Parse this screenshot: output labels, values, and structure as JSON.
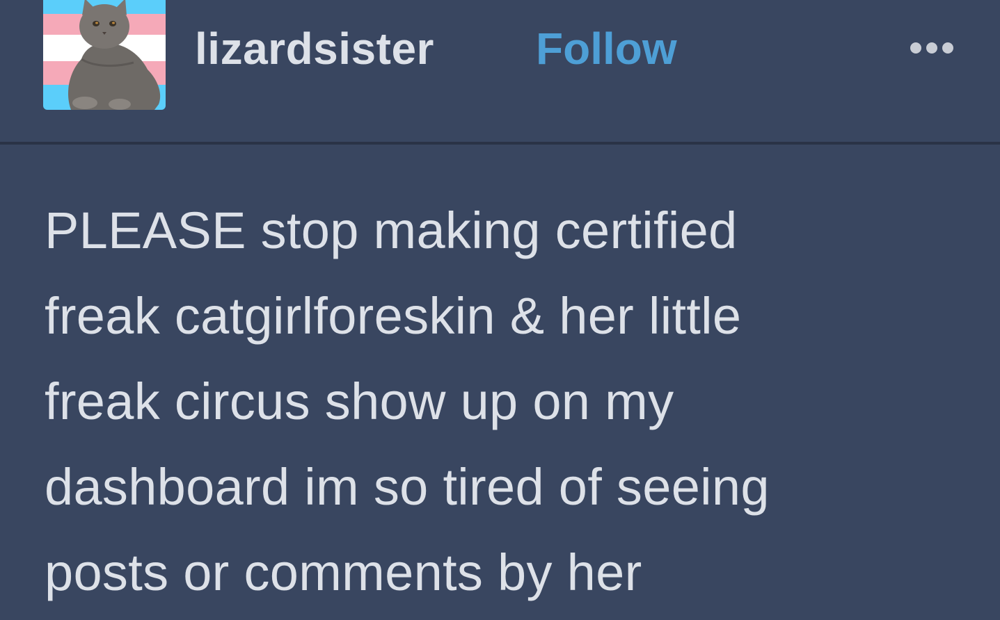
{
  "post": {
    "username": "lizardsister",
    "follow_label": "Follow",
    "more_icon": "ellipsis-icon",
    "body_text": "PLEASE stop making certified\nfreak catgirlforeskin & her little\nfreak circus show up on my\ndashboard im so tired of seeing\nposts or comments by her"
  },
  "colors": {
    "background": "#394660",
    "text": "#dde1e8",
    "accent": "#4e9fd6"
  }
}
